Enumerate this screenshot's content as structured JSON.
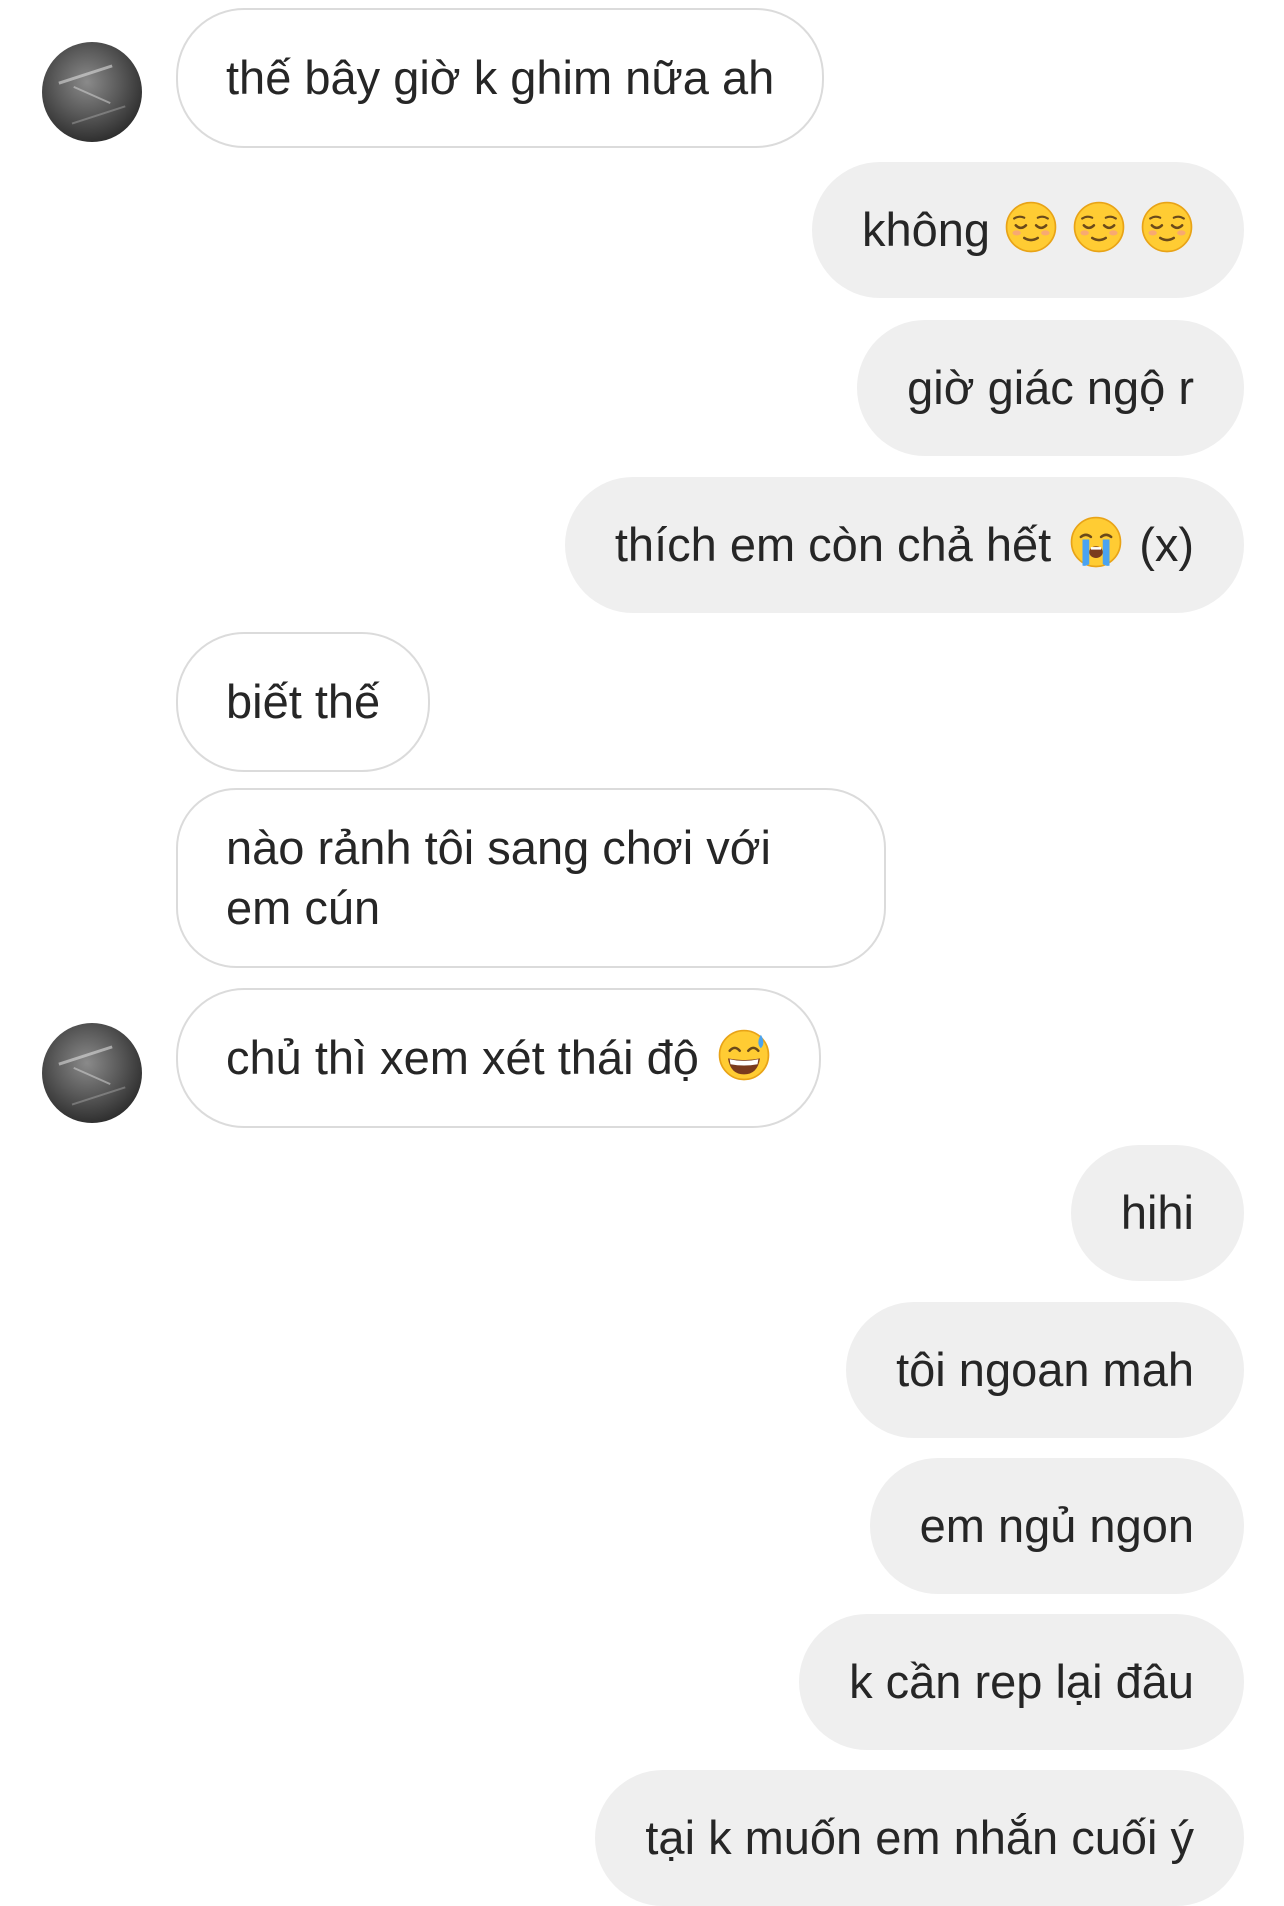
{
  "colors": {
    "incoming_bubble_bg": "#ffffff",
    "incoming_bubble_border": "#dbdbdb",
    "outgoing_bubble_bg": "#efefef",
    "text": "#262626"
  },
  "messages": [
    {
      "side": "incoming",
      "text": "thế bây giờ k ghim nữa ah",
      "avatar": true
    },
    {
      "side": "outgoing",
      "text": "không",
      "emoji": [
        "relieved-face",
        "relieved-face",
        "relieved-face"
      ]
    },
    {
      "side": "outgoing",
      "text": "giờ giác ngộ r"
    },
    {
      "side": "outgoing",
      "text_before": "thích em còn chả hết",
      "emoji": [
        "loudly-crying-face"
      ],
      "text_after": "(x)"
    },
    {
      "side": "incoming",
      "text": "biết thế"
    },
    {
      "side": "incoming",
      "line1": "nào rảnh tôi sang chơi với",
      "line2": "em cún"
    },
    {
      "side": "incoming",
      "text": "chủ thì xem xét thái độ",
      "emoji": [
        "grinning-face-with-sweat"
      ],
      "avatar": true
    },
    {
      "side": "outgoing",
      "text": "hihi"
    },
    {
      "side": "outgoing",
      "text": "tôi ngoan mah"
    },
    {
      "side": "outgoing",
      "text": "em ngủ ngon"
    },
    {
      "side": "outgoing",
      "text": "k cần rep lại đâu"
    },
    {
      "side": "outgoing",
      "text": "tại k muốn em nhắn cuối ý"
    }
  ]
}
